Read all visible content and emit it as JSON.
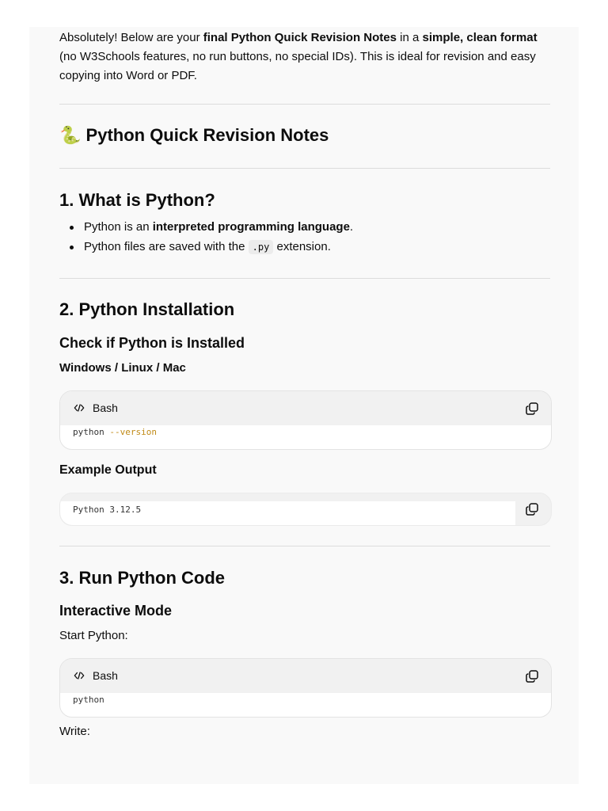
{
  "intro": {
    "p1": "Absolutely! Below are your ",
    "b1": "final Python Quick Revision Notes",
    "p2": " in a ",
    "b2": "simple, clean format",
    "p3": " (no W3Schools features, no run buttons, no special IDs). This is ideal for revision and easy copying into Word or PDF."
  },
  "title": {
    "emoji": "🐍",
    "text": "Python Quick Revision Notes"
  },
  "section1": {
    "heading": "1. What is Python?",
    "bullet1_pre": "Python is an ",
    "bullet1_bold": "interpreted programming language",
    "bullet1_post": ".",
    "bullet2_pre": "Python files are saved with the ",
    "bullet2_code": ".py",
    "bullet2_post": " extension."
  },
  "section2": {
    "heading": "2. Python Installation",
    "subheading": "Check if Python is Installed",
    "platforms": "Windows / Linux / Mac",
    "code1": {
      "lang": "Bash",
      "cmd": "python ",
      "flag": "--version"
    },
    "output_heading": "Example Output",
    "output": "Python 3.12.5"
  },
  "section3": {
    "heading": "3. Run Python Code",
    "subheading": "Interactive Mode",
    "start_text": "Start Python:",
    "code1": {
      "lang": "Bash",
      "cmd": "python"
    },
    "write_text": "Write:"
  },
  "icons": {
    "code": "code-brackets-icon",
    "copy": "copy-icon"
  }
}
